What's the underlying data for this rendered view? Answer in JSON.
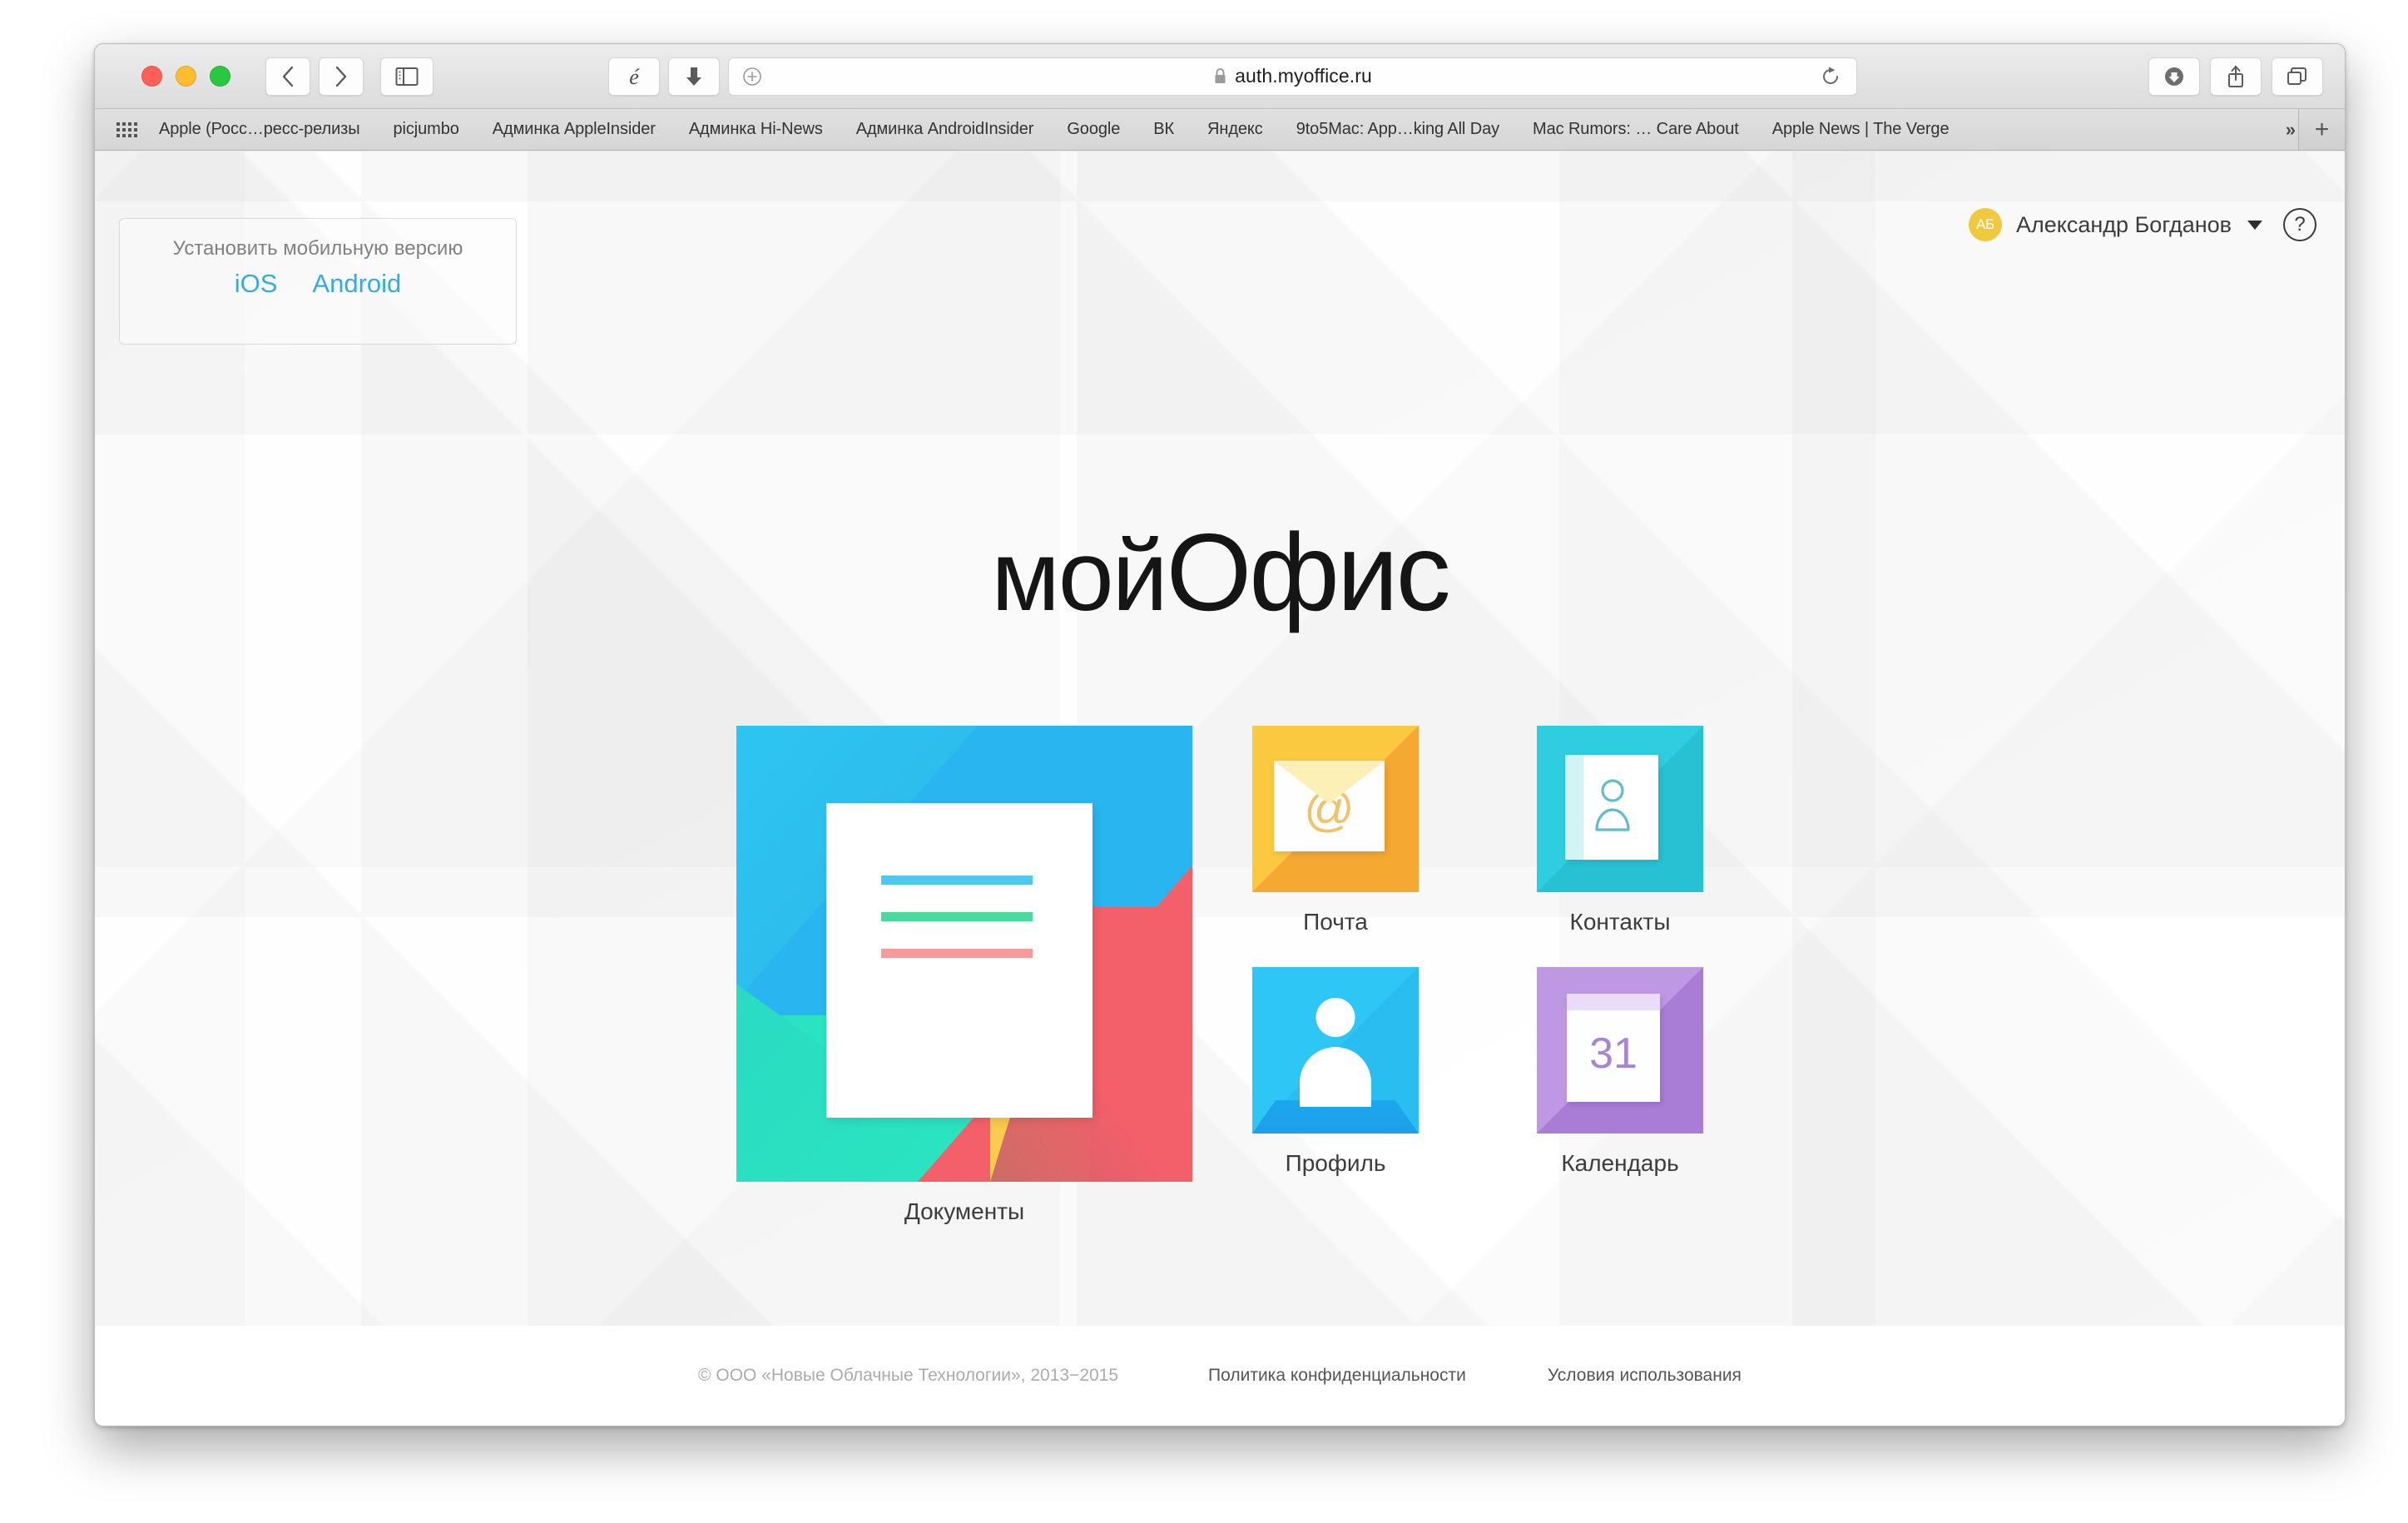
{
  "browser": {
    "url": "auth.myoffice.ru",
    "secure_icon": "lock-icon",
    "nav_back": "back-icon",
    "nav_forward": "forward-icon",
    "sidebar_toggle": "sidebar-icon",
    "reader_icon": "evernote-icon",
    "download_arrow_icon": "download-arrow-icon",
    "add_icon": "plus-circle-icon",
    "reload_icon": "reload-icon",
    "downloads_icon": "downloads-icon",
    "share_icon": "share-icon",
    "tabs_icon": "tabs-icon"
  },
  "bookmarks": {
    "grid_icon": "apps-grid-icon",
    "items": [
      "Apple (Росс…ресс-релизы",
      "picjumbo",
      "Админка AppleInsider",
      "Админка Hi-News",
      "Админка AndroidInsider",
      "Google",
      "ВК",
      "Яндекс",
      "9to5Mac: App…king All Day",
      "Mac Rumors: … Care About",
      "Apple News | The Verge"
    ],
    "overflow_label": "»",
    "add_label": "+"
  },
  "mobile_promo": {
    "title": "Установить мобильную версию",
    "links": [
      "iOS",
      "Android"
    ],
    "link_color": "#36abe0"
  },
  "user": {
    "initials": "АБ",
    "name": "Александр Богданов",
    "avatar_color": "#f0c93f",
    "caret_icon": "chevron-down-icon",
    "help_label": "?"
  },
  "logo": {
    "thin": "мой",
    "bold": "Офис"
  },
  "apps": {
    "documents": {
      "label": "Документы",
      "icon": "documents-icon",
      "accent": "#29b6f0"
    },
    "mail": {
      "label": "Почта",
      "icon": "mail-icon",
      "accent": "#fbc93f",
      "glyph": "@"
    },
    "contacts": {
      "label": "Контакты",
      "icon": "contacts-icon",
      "accent": "#2ecde0"
    },
    "profile": {
      "label": "Профиль",
      "icon": "profile-icon",
      "accent": "#2ec6f5"
    },
    "calendar": {
      "label": "Календарь",
      "icon": "calendar-icon",
      "accent": "#b68ae0",
      "day": "31"
    }
  },
  "footer": {
    "copyright": "© ООО «Новые Облачные Технологии», 2013−2015",
    "privacy": "Политика конфиденциальности",
    "terms": "Условия использования"
  }
}
